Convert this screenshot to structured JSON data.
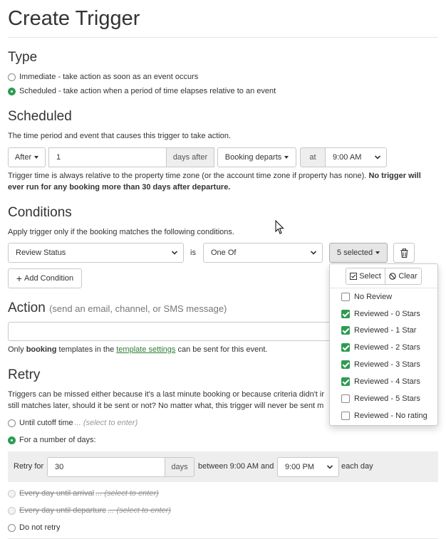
{
  "page": {
    "title": "Create Trigger"
  },
  "type": {
    "heading": "Type",
    "options": [
      {
        "label": "Immediate - take action as soon as an event occurs",
        "selected": false
      },
      {
        "label": "Scheduled - take action when a period of time elapses relative to an event",
        "selected": true
      }
    ]
  },
  "scheduled": {
    "heading": "Scheduled",
    "description": "The time period and event that causes this trigger to take action.",
    "direction": "After",
    "amount": "1",
    "unit_addon": "days after",
    "event": "Booking departs",
    "at_addon": "at",
    "time": "9:00 AM",
    "note_normal": "Trigger time is always relative to the property time zone (or the account time zone if property has none).",
    "note_bold_1": "No trigger will",
    "note_bold_2": "ever run for any booking more than 30 days after departure."
  },
  "conditions": {
    "heading": "Conditions",
    "description": "Apply trigger only if the booking matches the following conditions.",
    "field": "Review Status",
    "is_label": "is",
    "operator": "One Of",
    "multiselect_label": "5 selected",
    "add_button": "Add Condition",
    "dropdown": {
      "select_label": "Select",
      "clear_label": "Clear",
      "options": [
        {
          "label": "No Review",
          "checked": false
        },
        {
          "label": "Reviewed - 0 Stars",
          "checked": true
        },
        {
          "label": "Reviewed - 1 Star",
          "checked": true
        },
        {
          "label": "Reviewed - 2 Stars",
          "checked": true
        },
        {
          "label": "Reviewed - 3 Stars",
          "checked": true
        },
        {
          "label": "Reviewed - 4 Stars",
          "checked": true
        },
        {
          "label": "Reviewed - 5 Stars",
          "checked": false
        },
        {
          "label": "Reviewed - No rating",
          "checked": false
        }
      ]
    }
  },
  "action": {
    "heading": "Action",
    "subheading": "(send an email, channel, or SMS message)",
    "input_value": "",
    "help_1": "Only",
    "help_bold": "booking",
    "help_2": "templates in the",
    "help_link": "template settings",
    "help_3": "can be sent for this event."
  },
  "retry": {
    "heading": "Retry",
    "description_1": "Triggers can be missed either because it's a last minute booking or because criteria didn't ir",
    "description_2": "still matches later, should it be sent or not? No matter what, this trigger will never be sent m",
    "options": [
      {
        "label": "Until cutoff time",
        "hint": "... (select to enter)",
        "selected": false,
        "disabled": false
      },
      {
        "label": "For a number of days:",
        "hint": "",
        "selected": true,
        "disabled": false
      },
      {
        "label": "Every day until arrival",
        "hint": "... (select to enter)",
        "selected": false,
        "disabled": true
      },
      {
        "label": "Every day until departure",
        "hint": "... (select to enter)",
        "selected": false,
        "disabled": true
      },
      {
        "label": "Do not retry",
        "hint": "",
        "selected": false,
        "disabled": false
      }
    ],
    "retry_for_label": "Retry for",
    "days_value": "30",
    "days_addon": "days",
    "between_label": "between 9:00 AM and",
    "end_time": "9:00 PM",
    "each_day_label": "each day"
  },
  "colors": {
    "accent_green": "#2e9b53",
    "link_green": "#2e7d32",
    "addon_gray": "#eeeeee"
  }
}
